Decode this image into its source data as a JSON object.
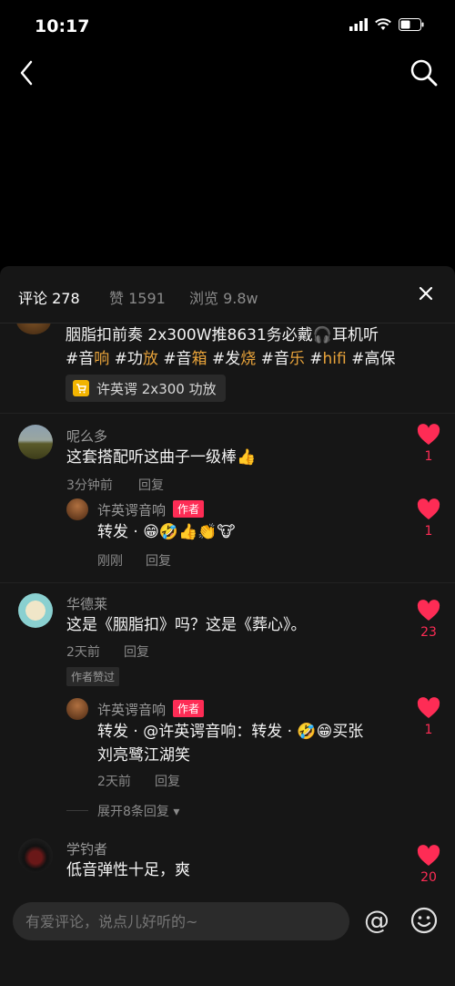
{
  "status": {
    "time": "10:17"
  },
  "tabs": {
    "comments_label": "评论 278",
    "likes_label": "赞 1591",
    "views_label": "浏览 9.8w"
  },
  "post": {
    "line1": "胭脂扣前奏 2x300W推8631务必戴🎧耳机听",
    "tags": [
      {
        "h": "#音",
        "w": "响"
      },
      {
        "h": "#功",
        "w": "放"
      },
      {
        "h": "#音",
        "w": "箱"
      },
      {
        "h": "#发",
        "w": "烧"
      },
      {
        "h": "#音",
        "w": "乐"
      },
      {
        "h": "#",
        "w": "hifi"
      },
      {
        "h": "#高保",
        "w": ""
      }
    ],
    "product_label": "许英谔 2x300 功放"
  },
  "comments": [
    {
      "user": "呢么多",
      "text": "这套搭配听这曲子一级棒👍",
      "time": "3分钟前",
      "reply_label": "回复",
      "likes": "1",
      "reply": {
        "user": "许英谔音响",
        "badge": "作者",
        "text": "转发 · 😁🤣👍👏🐮",
        "time": "刚刚",
        "reply_label": "回复",
        "likes": "1"
      }
    },
    {
      "user": "华德莱",
      "text": "这是《胭脂扣》吗？这是《葬心》。",
      "time": "2天前",
      "reply_label": "回复",
      "liked_by_author": "作者赞过",
      "likes": "23",
      "reply": {
        "user": "许英谔音响",
        "badge": "作者",
        "text_line1": "转发 · @许英谔音响：转发 · 🤣😁买张",
        "text_line2": "刘亮鹭江湖笑",
        "time": "2天前",
        "reply_label": "回复",
        "likes": "1"
      },
      "expand_label": "展开8条回复"
    },
    {
      "user": "学钓者",
      "text": "低音弹性十足，爽",
      "likes": "20"
    }
  ],
  "input": {
    "placeholder": "有爱评论，说点儿好听的~"
  },
  "colors": {
    "accent": "#fe2c55",
    "tag": "#e8a33a",
    "sheet": "#161616"
  },
  "icons": [
    "back-icon",
    "search-icon",
    "close-icon",
    "cart-icon",
    "heart-icon",
    "at-icon",
    "emoji-icon"
  ]
}
